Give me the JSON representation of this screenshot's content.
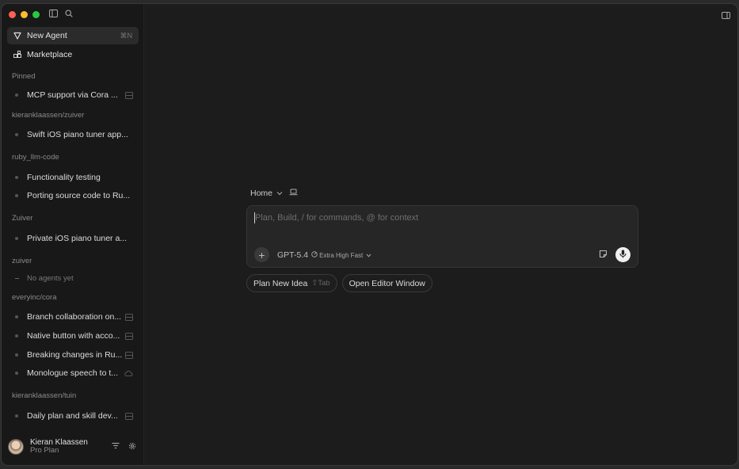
{
  "sidebar": {
    "new_agent": {
      "label": "New Agent",
      "shortcut": "⌘N"
    },
    "marketplace": {
      "label": "Marketplace"
    },
    "groups": [
      {
        "title": "Pinned",
        "items": [
          {
            "label": "MCP support via Cora ...",
            "trail": "stack"
          }
        ]
      },
      {
        "title": "kieranklaassen/zuiver",
        "items": [
          {
            "label": "Swift iOS piano tuner app..."
          }
        ]
      },
      {
        "title": "ruby_llm-code",
        "items": [
          {
            "label": "Functionality testing"
          },
          {
            "label": "Porting source code to Ru..."
          }
        ]
      },
      {
        "title": "Zuiver",
        "items": [
          {
            "label": "Private iOS piano tuner a..."
          }
        ]
      },
      {
        "title": "zuiver",
        "items": [
          {
            "label": "No agents yet",
            "empty": true
          }
        ]
      },
      {
        "title": "everyinc/cora",
        "items": [
          {
            "label": "Branch collaboration on...",
            "trail": "stack"
          },
          {
            "label": "Native button with acco...",
            "trail": "stack"
          },
          {
            "label": "Breaking changes in Ru...",
            "trail": "stack"
          },
          {
            "label": "Monologue speech to t...",
            "trail": "cloud"
          }
        ]
      },
      {
        "title": "kieranklaassen/tuin",
        "items": [
          {
            "label": "Daily plan and skill dev...",
            "trail": "stack"
          }
        ]
      }
    ],
    "user": {
      "name": "Kieran Klaassen",
      "plan": "Pro Plan"
    }
  },
  "main": {
    "breadcrumb": {
      "location": "Home"
    },
    "composer": {
      "placeholder": "Plan, Build, / for commands, @ for context",
      "model": "GPT-5.4",
      "speed": "Extra High Fast"
    },
    "chips": [
      {
        "label": "Plan New Idea",
        "hint": "⇧Tab"
      },
      {
        "label": "Open Editor Window"
      }
    ]
  },
  "colors": {
    "window_bg": "#1c1c1c",
    "sidebar_bg": "#181818",
    "composer_bg": "#262626"
  }
}
